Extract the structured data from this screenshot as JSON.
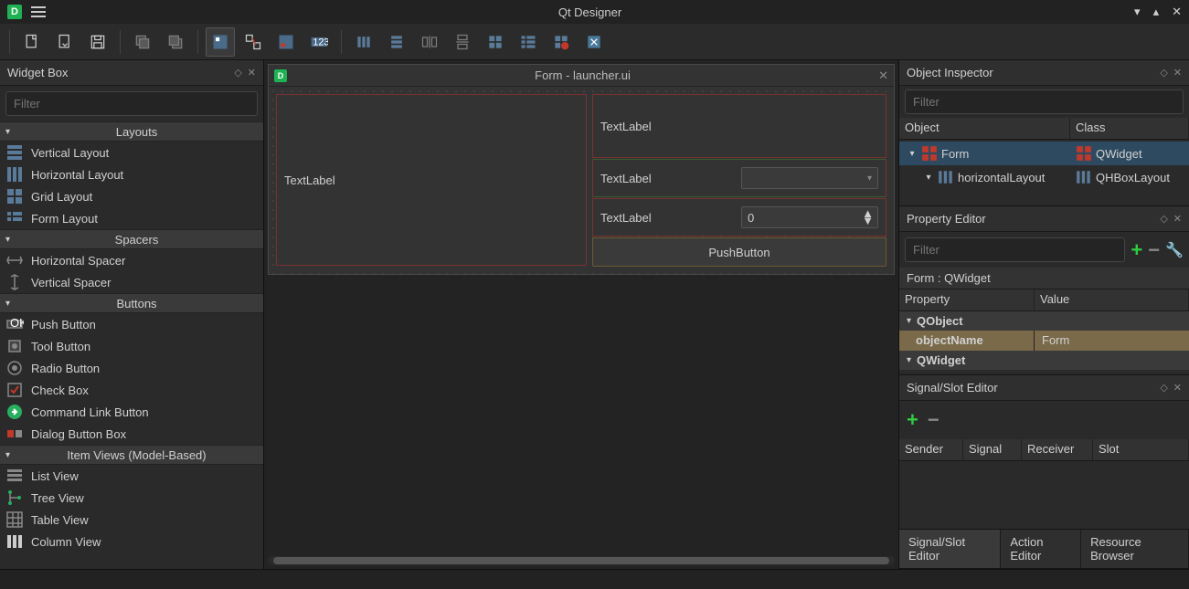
{
  "app": {
    "title": "Qt Designer"
  },
  "widget_box": {
    "title": "Widget Box",
    "filter_placeholder": "Filter",
    "categories": [
      {
        "name": "Layouts",
        "items": [
          "Vertical Layout",
          "Horizontal Layout",
          "Grid Layout",
          "Form Layout"
        ]
      },
      {
        "name": "Spacers",
        "items": [
          "Horizontal Spacer",
          "Vertical Spacer"
        ]
      },
      {
        "name": "Buttons",
        "items": [
          "Push Button",
          "Tool Button",
          "Radio Button",
          "Check Box",
          "Command Link Button",
          "Dialog Button Box"
        ]
      },
      {
        "name": "Item Views (Model-Based)",
        "items": [
          "List View",
          "Tree View",
          "Table View",
          "Column View"
        ]
      }
    ]
  },
  "form": {
    "window_title": "Form - launcher.ui",
    "left_label": "TextLabel",
    "row1_label": "TextLabel",
    "row2_label": "TextLabel",
    "row3_label": "TextLabel",
    "spin_value": "0",
    "button_label": "PushButton"
  },
  "object_inspector": {
    "title": "Object Inspector",
    "filter_placeholder": "Filter",
    "headers": {
      "object": "Object",
      "class": "Class"
    },
    "rows": [
      {
        "name": "Form",
        "class": "QWidget",
        "indent": 0,
        "selected": true,
        "icon": "grid"
      },
      {
        "name": "horizontalLayout",
        "class": "QHBoxLayout",
        "indent": 1,
        "selected": false,
        "icon": "hlayout"
      }
    ]
  },
  "property_editor": {
    "title": "Property Editor",
    "filter_placeholder": "Filter",
    "context": "Form : QWidget",
    "headers": {
      "property": "Property",
      "value": "Value"
    },
    "groups": [
      {
        "name": "QObject",
        "rows": [
          {
            "key": "objectName",
            "value": "Form",
            "highlight": true
          }
        ]
      },
      {
        "name": "QWidget",
        "rows": []
      }
    ]
  },
  "signal_slot": {
    "title": "Signal/Slot Editor",
    "headers": {
      "sender": "Sender",
      "signal": "Signal",
      "receiver": "Receiver",
      "slot": "Slot"
    }
  },
  "bottom_tabs": {
    "t1": "Signal/Slot Editor",
    "t2": "Action Editor",
    "t3": "Resource Browser"
  }
}
